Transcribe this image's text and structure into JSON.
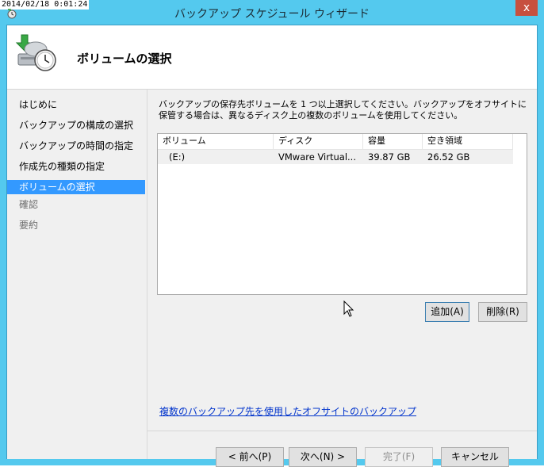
{
  "timestamp": "2014/02/18 0:01:24",
  "window": {
    "title": "バックアップ スケジュール ウィザード",
    "close_glyph": "x"
  },
  "header": {
    "page_title": "ボリュームの選択"
  },
  "sidebar": {
    "items": [
      {
        "label": "はじめに",
        "state": "normal"
      },
      {
        "label": "バックアップの構成の選択",
        "state": "normal"
      },
      {
        "label": "バックアップの時間の指定",
        "state": "normal"
      },
      {
        "label": "作成先の種類の指定",
        "state": "normal"
      },
      {
        "label": "ボリュームの選択",
        "state": "active"
      },
      {
        "label": "確認",
        "state": "disabled"
      },
      {
        "label": "要約",
        "state": "disabled"
      }
    ]
  },
  "main": {
    "description": "バックアップの保存先ボリュームを 1 つ以上選択してください。バックアップをオフサイトに保管する場合は、異なるディスク上の複数のボリュームを使用してください。",
    "table": {
      "columns": [
        "ボリューム",
        "ディスク",
        "容量",
        "空き領域"
      ],
      "rows": [
        [
          "(E:)",
          "VMware Virtual...",
          "39.87 GB",
          "26.52 GB"
        ]
      ]
    },
    "add_button": "追加(A)",
    "remove_button": "削除(R)",
    "offsite_link": "複数のバックアップ先を使用したオフサイトのバックアップ"
  },
  "footer": {
    "back_button": "< 前へ(P)",
    "next_button": "次へ(N) >",
    "finish_button": "完了(F)",
    "cancel_button": "キャンセル"
  },
  "colors": {
    "titlebar": "#54c9ee",
    "active_nav": "#3399ff",
    "link": "#0033cc",
    "close": "#c7503f"
  }
}
